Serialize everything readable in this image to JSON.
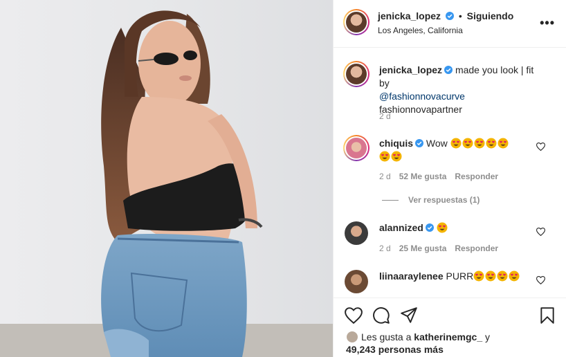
{
  "post": {
    "username": "jenicka_lopez",
    "follow_status": "Siguiendo",
    "location": "Los Angeles, California",
    "caption_text": "made you look | fit by",
    "caption_mention": "@fashionnovacurve",
    "caption_tag": "fashionnovapartner",
    "caption_time": "2 d"
  },
  "comments": [
    {
      "user": "chiquis",
      "text": "Wow",
      "emojis": 7,
      "time": "2 d",
      "likes": "52 Me gusta",
      "reply": "Responder",
      "view_replies": "Ver respuestas (1)"
    },
    {
      "user": "alannized",
      "text": "",
      "emojis": 1,
      "time": "2 d",
      "likes": "25 Me gusta",
      "reply": "Responder"
    },
    {
      "user": "liinaaraylenee",
      "text": "PURR",
      "emojis": 4
    }
  ],
  "likes": {
    "prefix": "Les gusta a",
    "user": "katherinemgc_",
    "connector": "y",
    "count": "49,243 personas más"
  },
  "icons": {
    "more": "more-options-icon",
    "like": "heart-icon",
    "comment": "comment-icon",
    "share": "share-icon",
    "save": "bookmark-icon",
    "verified": "verified-badge-icon",
    "emoji": "heart-eyes-emoji"
  },
  "colors": {
    "verified": "#3897f0",
    "link": "#00376b",
    "muted": "#8e8e8e",
    "emoji": "#f4b400"
  }
}
